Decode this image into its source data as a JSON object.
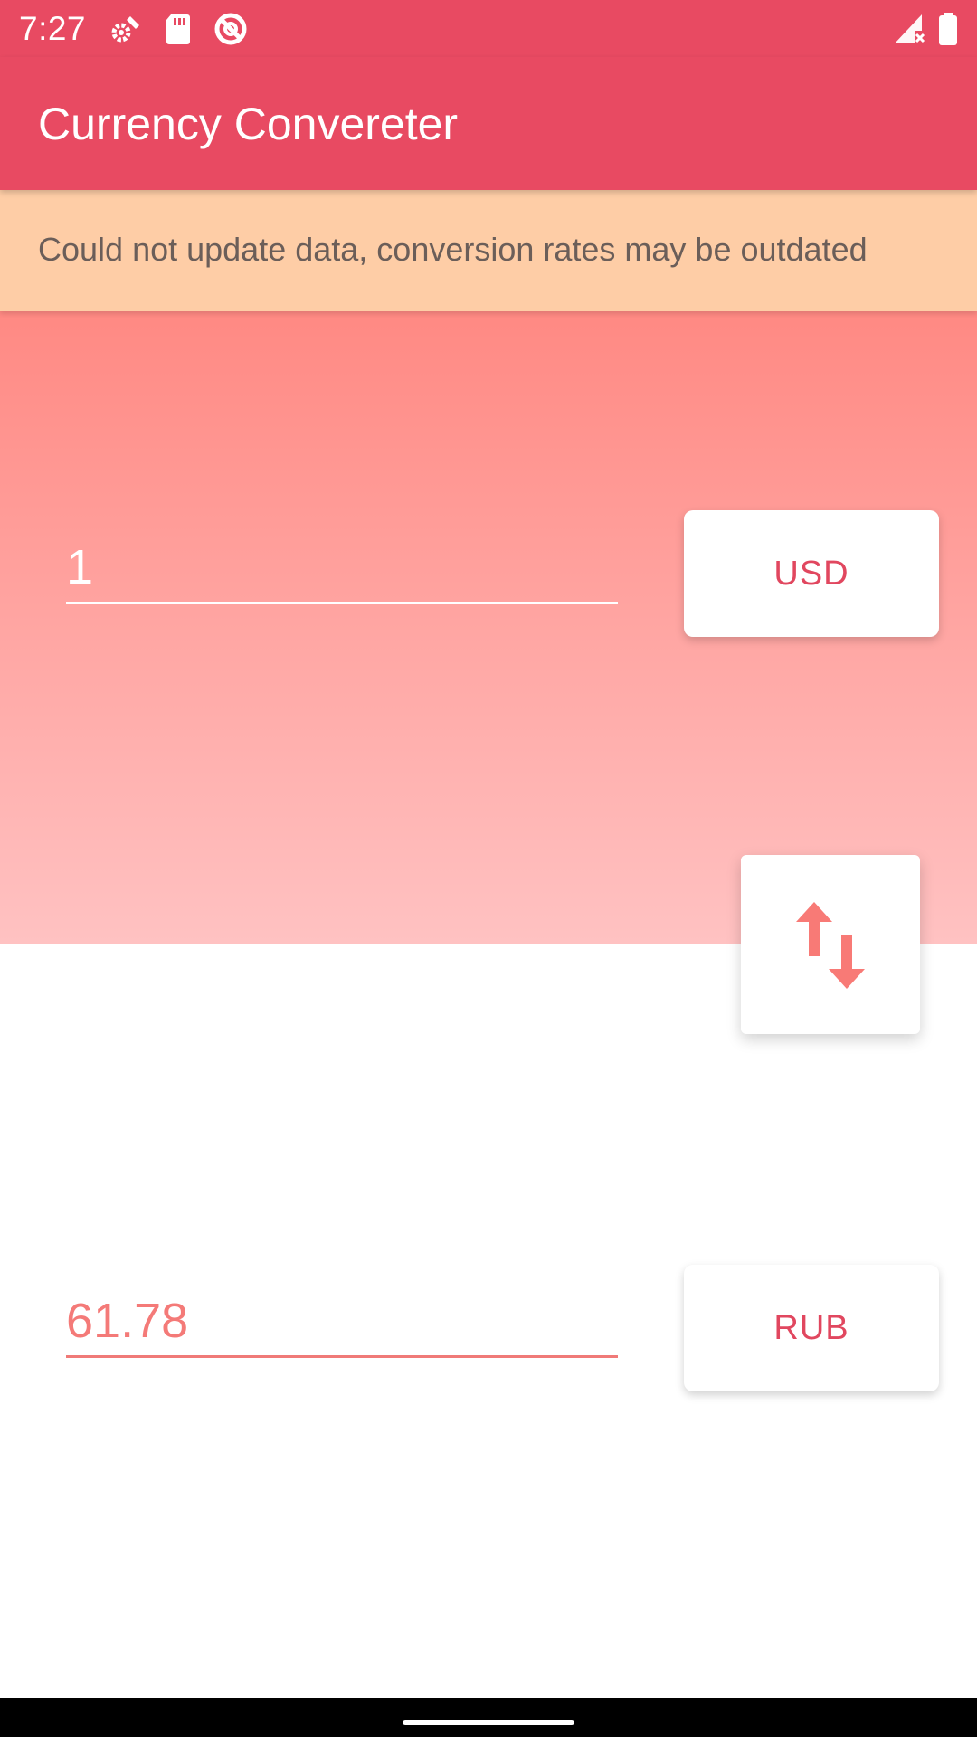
{
  "status_bar": {
    "time": "7:27",
    "icons": [
      "settings-sync-icon",
      "sd-card-icon",
      "no-sync-icon",
      "signal-no-service-icon",
      "battery-icon"
    ]
  },
  "app_bar": {
    "title": "Currency Convereter"
  },
  "banner": {
    "message": "Could not update data, conversion rates may be outdated"
  },
  "converter": {
    "from": {
      "amount": "1",
      "currency": "USD"
    },
    "to": {
      "amount": "61.78",
      "currency": "RUB"
    },
    "swap_icon": "swap-vertical-icon"
  },
  "colors": {
    "primary": "#e84a62",
    "banner_bg": "#fecda6",
    "gradient_top": "#ff8983",
    "gradient_bottom": "#ffc2c2",
    "accent": "#f47a78"
  }
}
